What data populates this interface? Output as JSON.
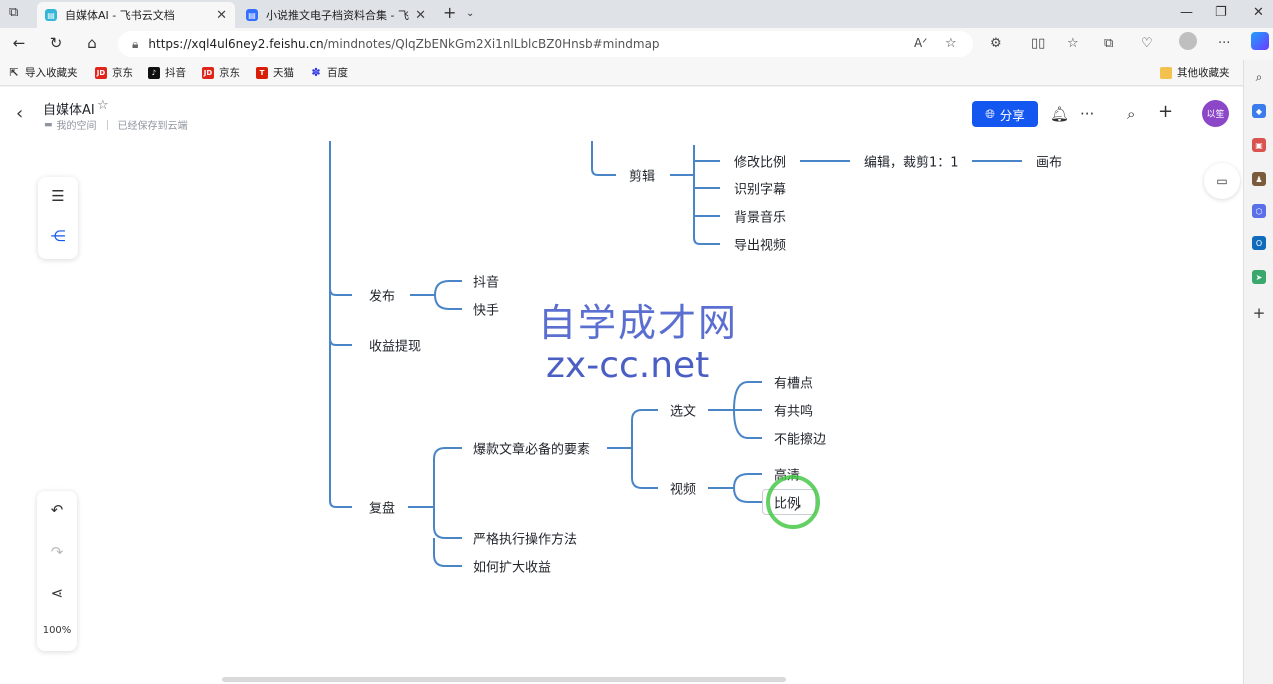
{
  "browser": {
    "tabs": [
      {
        "title": "自媒体AI - 飞书云文档",
        "active": true
      },
      {
        "title": "小说推文电子档资料合集 - 飞书云文档",
        "active": false
      }
    ],
    "address": {
      "host": "https://xql4ul6ney2.feishu.cn",
      "path": "/mindnotes/QlqZbENkGm2Xi1nlLblcBZ0Hnsb#mindmap"
    },
    "read_aloud_label": "A̅",
    "bookmarks": [
      {
        "label": "导入收藏夹",
        "icon": "import-icon"
      },
      {
        "label": "京东",
        "icon": "jd-icon",
        "color": "#e1251b"
      },
      {
        "label": "抖音",
        "icon": "douyin-icon",
        "color": "#111111"
      },
      {
        "label": "京东",
        "icon": "jd-icon",
        "color": "#e1251b"
      },
      {
        "label": "天猫",
        "icon": "tmall-icon",
        "color": "#d81e06"
      },
      {
        "label": "百度",
        "icon": "baidu-icon",
        "color": "#2932e1"
      }
    ],
    "other_bookmarks": "其他收藏夹"
  },
  "doc": {
    "title": "自媒体AI",
    "breadcrumb": "我的空间",
    "save_status": "已经保存到云端",
    "share_label": "分享",
    "avatar_text": "以笙",
    "accent": "#1456f0"
  },
  "mindmap": {
    "nodes": {
      "jianji": "剪辑",
      "xiugai": "修改比例",
      "bianji": "编辑，裁剪1：1",
      "huabu": "画布",
      "shibie": "识别字幕",
      "beijing": "背景音乐",
      "daochu": "导出视频",
      "fabu": "发布",
      "douyin": "抖音",
      "kuaishou": "快手",
      "shouyi": "收益提现",
      "fupan": "复盘",
      "baokuan": "爆款文章必备的要素",
      "xuanwen": "选文",
      "youcao": "有槽点",
      "yougong": "有共鸣",
      "bunengca": "不能擦边",
      "shipin": "视频",
      "gaoqing": "高清",
      "bili": "比例",
      "yange": "严格执行操作方法",
      "ruhe": "如何扩大收益"
    },
    "line_color": "#4a86c7"
  },
  "toolbar": {
    "zoom": "100%"
  },
  "watermark": {
    "cn": "自学成才网",
    "en": "zx-cc.net"
  }
}
